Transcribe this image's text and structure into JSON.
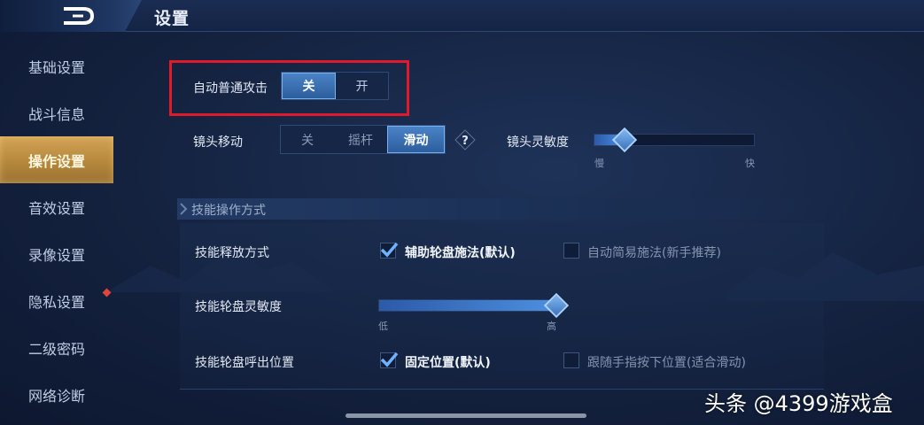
{
  "header": {
    "title": "设置",
    "back_icon": "back-arrow-icon"
  },
  "sidebar": {
    "items": [
      {
        "label": "基础设置",
        "active": false
      },
      {
        "label": "战斗信息",
        "active": false
      },
      {
        "label": "操作设置",
        "active": true
      },
      {
        "label": "音效设置",
        "active": false
      },
      {
        "label": "录像设置",
        "active": false
      },
      {
        "label": "隐私设置",
        "active": false,
        "badge": "red-dot"
      },
      {
        "label": "二级密码",
        "active": false
      },
      {
        "label": "网络诊断",
        "active": false
      }
    ]
  },
  "auto_attack": {
    "label": "自动普通攻击",
    "options": [
      "关",
      "开"
    ],
    "selected": "关"
  },
  "camera_move": {
    "label": "镜头移动",
    "options": [
      "关",
      "摇杆",
      "滑动"
    ],
    "selected": "滑动",
    "help": "?"
  },
  "camera_sensitivity": {
    "label": "镜头灵敏度",
    "min_label": "慢",
    "max_label": "快",
    "value_fraction": 0.19
  },
  "skill_section": {
    "title": "技能操作方式",
    "release_mode": {
      "label": "技能释放方式",
      "options": [
        {
          "text": "辅助轮盘施法(默认)",
          "checked": true
        },
        {
          "text": "自动简易施法(新手推荐)",
          "checked": false
        }
      ]
    },
    "wheel_sensitivity": {
      "label": "技能轮盘灵敏度",
      "min_label": "低",
      "max_label": "高",
      "value_fraction": 1.0
    },
    "wheel_position": {
      "label": "技能轮盘呼出位置",
      "options": [
        {
          "text": "固定位置(默认)",
          "checked": true
        },
        {
          "text": "跟随手指按下位置(适合滑动)",
          "checked": false
        }
      ]
    }
  },
  "watermark": "头条 @4399游戏盒",
  "colors": {
    "accent_blue": "#3d74bc",
    "active_gold": "#c49446",
    "highlight_red": "#e0192b",
    "background": "#14223f"
  }
}
